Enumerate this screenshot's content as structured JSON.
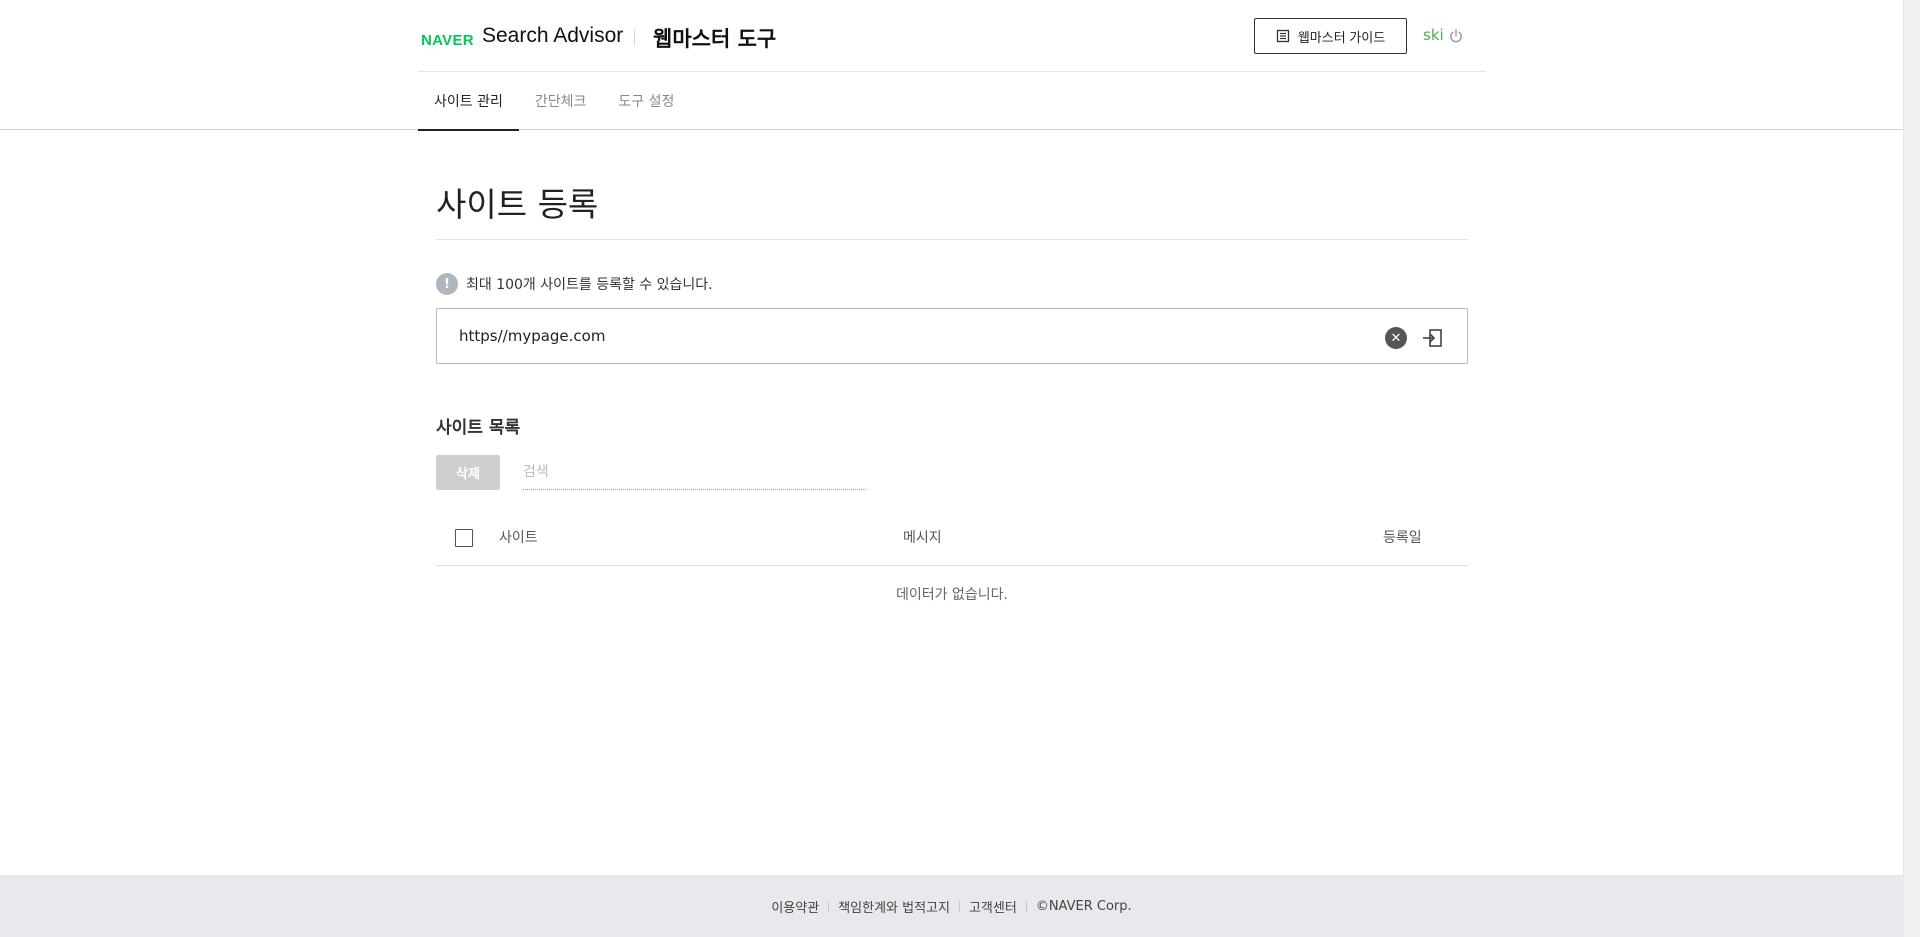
{
  "header": {
    "logo_brand": "NAVER",
    "logo_product": "Search Advisor",
    "logo_tool": "웹마스터 도구",
    "guide_button": "웹마스터 가이드",
    "user_name": "ski"
  },
  "tabs": [
    {
      "label": "사이트 관리",
      "active": true
    },
    {
      "label": "간단체크",
      "active": false
    },
    {
      "label": "도구 설정",
      "active": false
    }
  ],
  "main": {
    "title": "사이트 등록",
    "notice": "최대 100개 사이트를 등록할 수 있습니다.",
    "url_value": "https//mypage.com",
    "list_title": "사이트 목록",
    "delete_label": "삭제",
    "search_placeholder": "검색",
    "columns": {
      "site": "사이트",
      "message": "메시지",
      "date": "등록일"
    },
    "empty_text": "데이터가 없습니다."
  },
  "footer": {
    "links": [
      "이용약관",
      "책임한계와 법적고지",
      "고객센터"
    ],
    "copyright": "©NAVER Corp."
  },
  "colors": {
    "brand_green": "#03c75a",
    "user_green": "#4caf50",
    "footer_bg": "#e8e9ec"
  }
}
